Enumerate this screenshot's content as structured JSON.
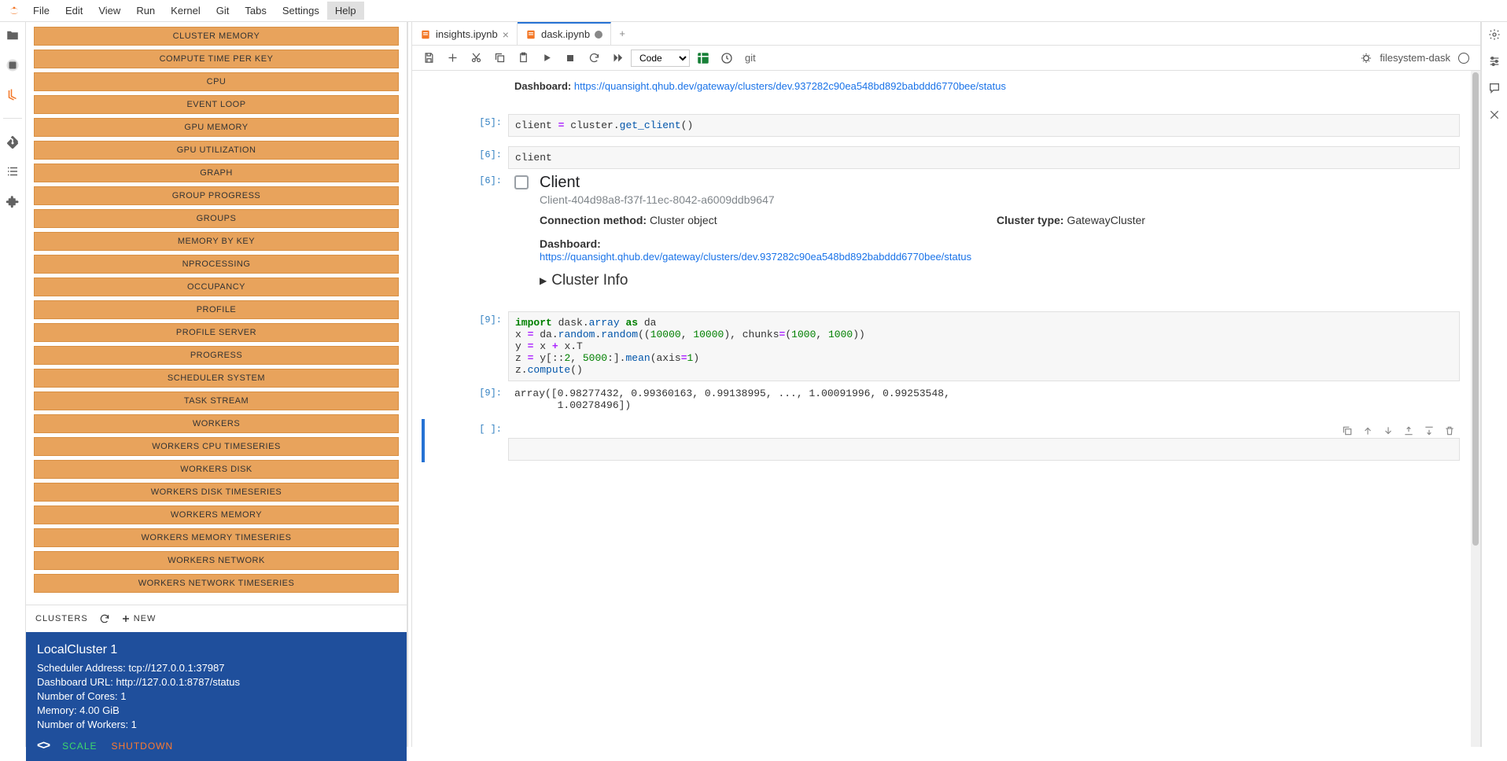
{
  "menu": [
    "File",
    "Edit",
    "View",
    "Run",
    "Kernel",
    "Git",
    "Tabs",
    "Settings",
    "Help"
  ],
  "menu_active_index": 8,
  "dashboard_buttons": [
    "CLUSTER MEMORY",
    "COMPUTE TIME PER KEY",
    "CPU",
    "EVENT LOOP",
    "GPU MEMORY",
    "GPU UTILIZATION",
    "GRAPH",
    "GROUP PROGRESS",
    "GROUPS",
    "MEMORY BY KEY",
    "NPROCESSING",
    "OCCUPANCY",
    "PROFILE",
    "PROFILE SERVER",
    "PROGRESS",
    "SCHEDULER SYSTEM",
    "TASK STREAM",
    "WORKERS",
    "WORKERS CPU TIMESERIES",
    "WORKERS DISK",
    "WORKERS DISK TIMESERIES",
    "WORKERS MEMORY",
    "WORKERS MEMORY TIMESERIES",
    "WORKERS NETWORK",
    "WORKERS NETWORK TIMESERIES"
  ],
  "clusters_header": {
    "title": "CLUSTERS",
    "new": "NEW"
  },
  "cluster": {
    "title": "LocalCluster 1",
    "rows": [
      "Scheduler Address: tcp://127.0.0.1:37987",
      "Dashboard URL: http://127.0.0.1:8787/status",
      "Number of Cores: 1",
      "Memory: 4.00 GiB",
      "Number of Workers: 1"
    ],
    "scale": "SCALE",
    "shutdown": "SHUTDOWN"
  },
  "tabs": [
    {
      "label": "insights.ipynb",
      "dirty": false,
      "active": false
    },
    {
      "label": "dask.ipynb",
      "dirty": true,
      "active": true
    }
  ],
  "toolbar": {
    "cell_type": "Code",
    "git": "git",
    "kernel": "filesystem-dask"
  },
  "cells": {
    "dashboard_label": "Dashboard:",
    "dashboard_url": "https://quansight.qhub.dev/gateway/clusters/dev.937282c90ea548bd892babddd6770bee/status",
    "p5": "[5]:",
    "c5": "client = cluster.get_client()",
    "p6": "[6]:",
    "c6": "client",
    "p6o": "[6]:",
    "client": {
      "title": "Client",
      "sub": "Client-404d98a8-f37f-11ec-8042-a6009ddb9647",
      "conn_label": "Connection method:",
      "conn_val": "Cluster object",
      "type_label": "Cluster type:",
      "type_val": "GatewayCluster",
      "dash_label": "Dashboard:",
      "dash_url": "https://quansight.qhub.dev/gateway/clusters/dev.937282c90ea548bd892babddd6770bee/status",
      "cluster_info": "Cluster Info"
    },
    "p9": "[9]:",
    "p9o": "[9]:",
    "c9_out": "array([0.98277432, 0.99360163, 0.99138995, ..., 1.00091996, 0.99253548,\n       1.00278496])",
    "pempty": "[ ]:"
  }
}
